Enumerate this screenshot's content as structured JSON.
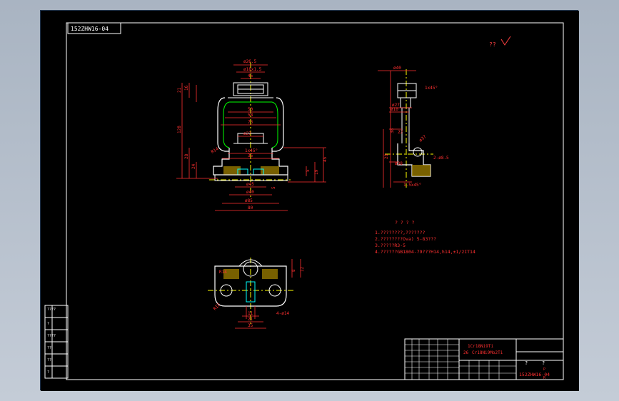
{
  "drawing": {
    "code_top": "152ZHW16-04",
    "roughness": "??",
    "tech_req": {
      "title": "? ? ? ?",
      "lines": [
        "1.????????,???????",
        "2.????????Ova) 5-83???",
        "3.?????R3-5",
        "4.??????GB1804-79???H14,h14,±1/2IT14"
      ]
    },
    "front_view": {
      "dims": {
        "d_top1": "ø26.5",
        "d_top2": "ø18x1.5",
        "d_top3": "45",
        "w50": "50",
        "w58": "58",
        "w73": "73",
        "d_mid": "ø27",
        "h21": "21",
        "h16": "16",
        "h128": "128",
        "h28": "28",
        "h5": "5",
        "h45": "45",
        "h19": "19",
        "h24": "24",
        "r14": "R14",
        "d45b": "ø45",
        "d40": "ø40",
        "d85": "ø85",
        "w80": "80",
        "w35": "35",
        "s1": "1x45°",
        "m5": "5"
      }
    },
    "side_view": {
      "dims": {
        "d_top": "ø40",
        "chamfer": "1x45°",
        "d27": "ø27",
        "d10": "ø10",
        "h38": "38",
        "w22": "22",
        "d37": "ø37",
        "r8": "2-ø8.5",
        "d38": "ø38",
        "bottom": "1.5x45°",
        "h20": "20"
      }
    },
    "top_view": {
      "dims": {
        "r14": "R14",
        "w21": "21",
        "w35": "35",
        "w11": "11",
        "h8": "8",
        "h12": "12",
        "r12": "R12",
        "holes": "4-ø14"
      }
    },
    "title_block": {
      "line1": "1Cr18Ni9Ti",
      "line2": "26",
      "line3": "Cr18Ni9Mo2Ti",
      "char1": "?",
      "char2": "?",
      "code": "152ZHW16-04",
      "code_sup": "P",
      "code_sub": "R"
    },
    "left_table": [
      "????",
      "?",
      "????",
      "??",
      "??",
      "?"
    ]
  }
}
